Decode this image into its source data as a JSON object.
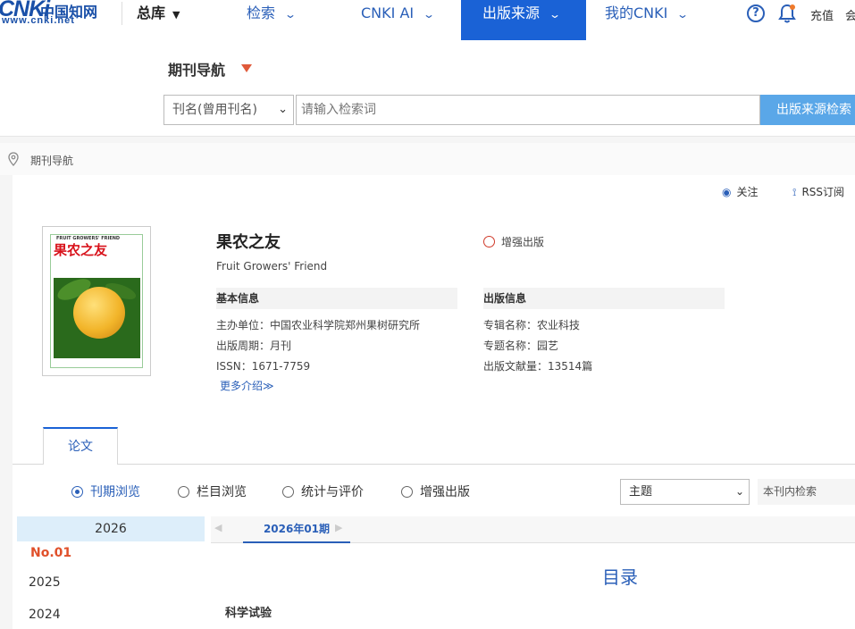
{
  "topnav": {
    "logo_main": "CNKi",
    "logo_cn": "中国知网",
    "logo_url": "www.cnki.net",
    "zongku": "总库",
    "items": [
      {
        "label": "检索"
      },
      {
        "label": "CNKI AI"
      },
      {
        "label": "出版来源"
      },
      {
        "label": "我的CNKI"
      }
    ],
    "recharge": "充值",
    "member": "会"
  },
  "search": {
    "title": "期刊导航",
    "select_value": "刊名(曾用刊名)",
    "placeholder": "请输入检索词",
    "button": "出版来源检索"
  },
  "breadcrumb": "期刊导航",
  "actions": {
    "follow": "关注",
    "rss": "RSS订阅"
  },
  "journal": {
    "cover_en": "FRUIT GROWERS' FRIEND",
    "cover_title": "果农之友",
    "title": "果农之友",
    "title_en": "Fruit Growers' Friend",
    "enhanced": "增强出版",
    "basic_header": "基本信息",
    "pub_header": "出版信息",
    "basic": [
      {
        "k": "主办单位：",
        "v": "中国农业科学院郑州果树研究所"
      },
      {
        "k": "出版周期：",
        "v": "月刊"
      },
      {
        "k": "ISSN：",
        "v": "1671-7759"
      }
    ],
    "pub": [
      {
        "k": "专辑名称：",
        "v": "农业科技"
      },
      {
        "k": "专题名称：",
        "v": "园艺"
      },
      {
        "k": "出版文献量：",
        "v": "13514篇"
      }
    ],
    "more": "更多介绍"
  },
  "tabs": {
    "paper": "论文"
  },
  "browse": {
    "options": [
      "刊期浏览",
      "栏目浏览",
      "统计与评价",
      "增强出版"
    ],
    "topic": "主题",
    "in_search": "本刊内检索"
  },
  "years": {
    "current": "2026",
    "issue": "No.01",
    "others": [
      "2025",
      "2024"
    ]
  },
  "issue_tab": "2026年01期",
  "toc": {
    "title": "目录",
    "section": "科学试验"
  }
}
